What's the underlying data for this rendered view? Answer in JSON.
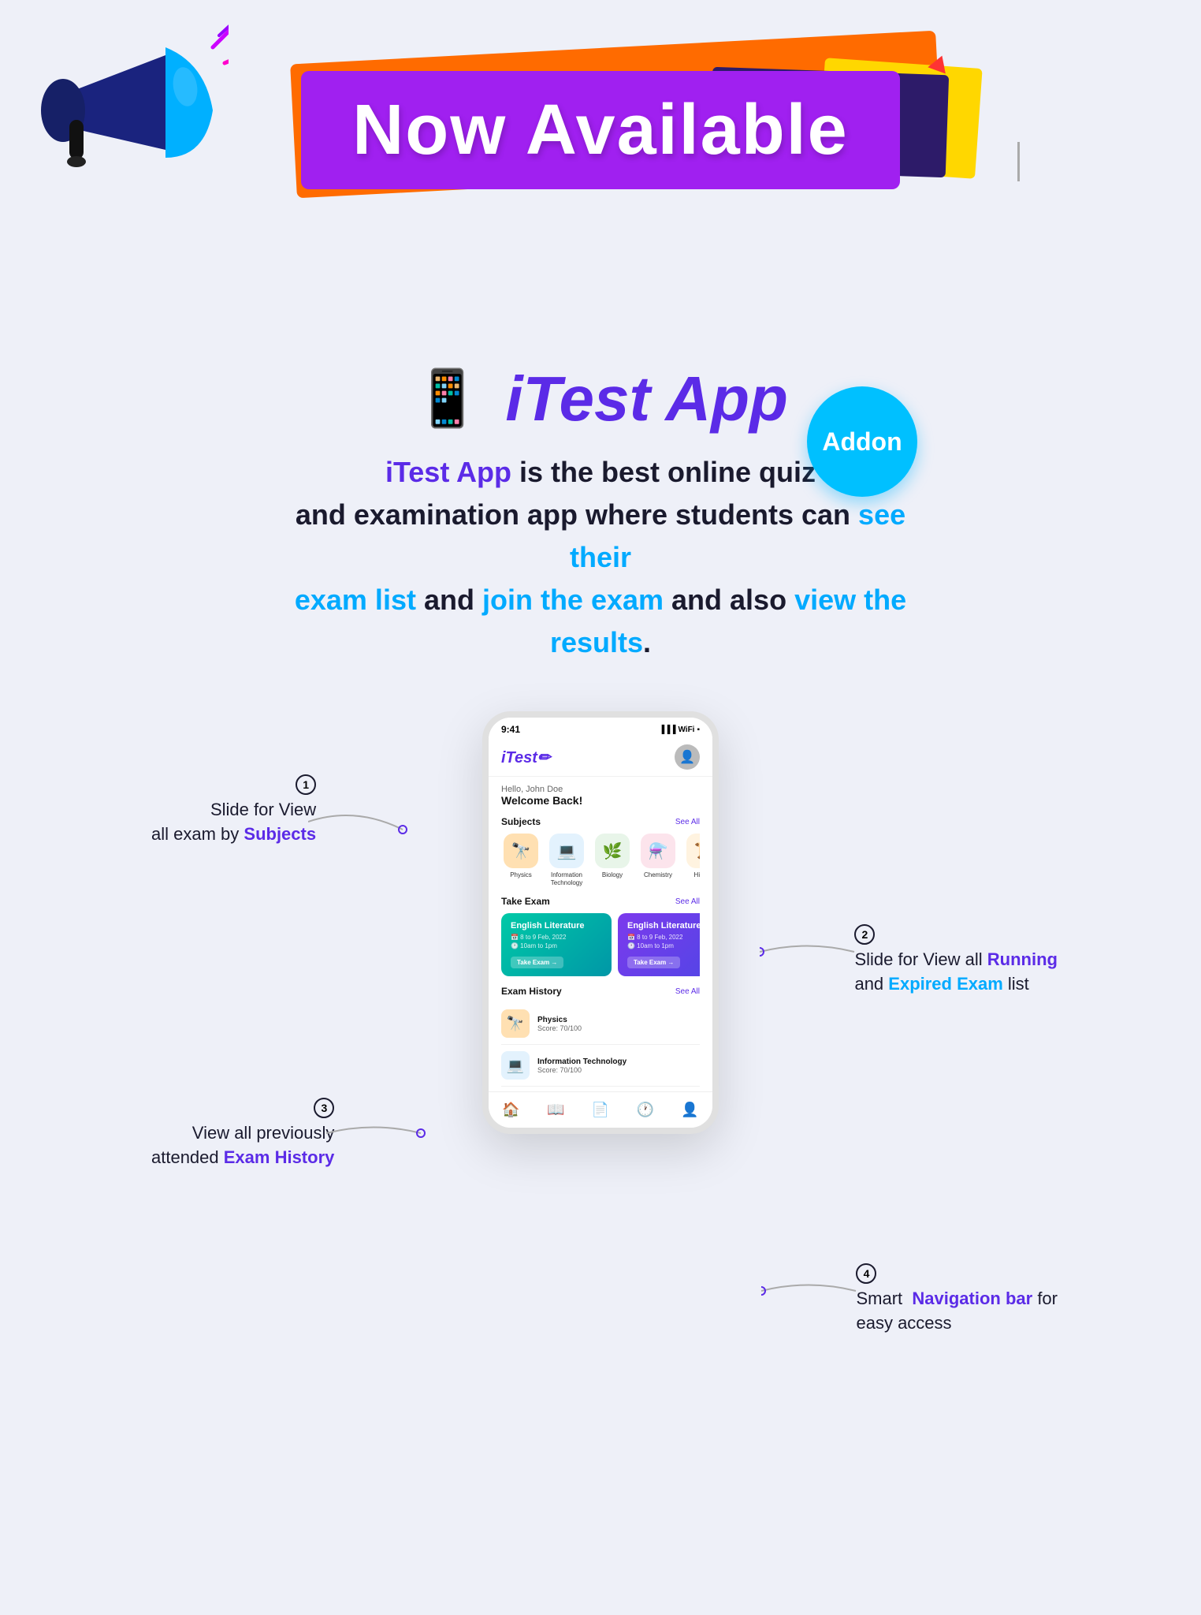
{
  "hero": {
    "banner_text": "Now Available",
    "app_name": "iTest App",
    "addon_label": "Addon"
  },
  "description": {
    "part1": "iTest App",
    "part2": " is the best online quiz",
    "part3": "and examination app where students can ",
    "part4": "see their",
    "part5": "exam list",
    "part6": " and ",
    "part7": "join the exam",
    "part8": " and also ",
    "part9": "view the results",
    "part10": "."
  },
  "phone": {
    "status_time": "9:41",
    "status_signal": "●●●",
    "status_wifi": "WiFi",
    "status_battery": "■",
    "logo": "iTest✏",
    "greeting": "Hello, John Doe",
    "welcome": "Welcome Back!",
    "subjects_title": "Subjects",
    "see_all": "See All",
    "subjects": [
      {
        "label": "Physics",
        "icon": "🔭",
        "bg": "#ffe0b2"
      },
      {
        "label": "Information\nTechnology",
        "icon": "💻",
        "bg": "#e3f2fd"
      },
      {
        "label": "Biology",
        "icon": "🌿",
        "bg": "#e8f5e9"
      },
      {
        "label": "Chemistry",
        "icon": "⚗️",
        "bg": "#fce4ec"
      },
      {
        "label": "History",
        "icon": "📜",
        "bg": "#fff3e0"
      }
    ],
    "take_exam_title": "Take Exam",
    "exams": [
      {
        "name": "English Literature",
        "date": "8 to 9 Feb, 2022",
        "time": "10am to 1pm",
        "btn": "Take Exam →",
        "style": "teal"
      },
      {
        "name": "English Literature",
        "date": "8 to 9 Feb, 2022",
        "time": "10am to 1pm",
        "btn": "Take Exam →",
        "style": "purple"
      }
    ],
    "history_title": "Exam History",
    "history": [
      {
        "name": "Physics",
        "score": "Score: 70/100",
        "icon": "🔭",
        "bg": "#ffe0b2"
      },
      {
        "name": "Information Technology",
        "score": "Score: 70/100",
        "icon": "💻",
        "bg": "#e3f2fd"
      }
    ],
    "nav_icons": [
      "🏠",
      "📖",
      "📄",
      "🕐",
      "👤"
    ]
  },
  "annotations": [
    {
      "number": "1",
      "line1": "Slide for View",
      "line2": "all exam by ",
      "accent": "Subjects"
    },
    {
      "number": "2",
      "line1": "Slide for View all ",
      "accent1": "Running",
      "line2": "and ",
      "accent2": "Expired Exam",
      "line3": " list"
    },
    {
      "number": "3",
      "line1": "View all previously",
      "line2": "attended ",
      "accent": "Exam History"
    },
    {
      "number": "4",
      "line1": "Smart  ",
      "accent": "Navigation bar",
      "line2": " for",
      "line3": "easy access"
    }
  ]
}
